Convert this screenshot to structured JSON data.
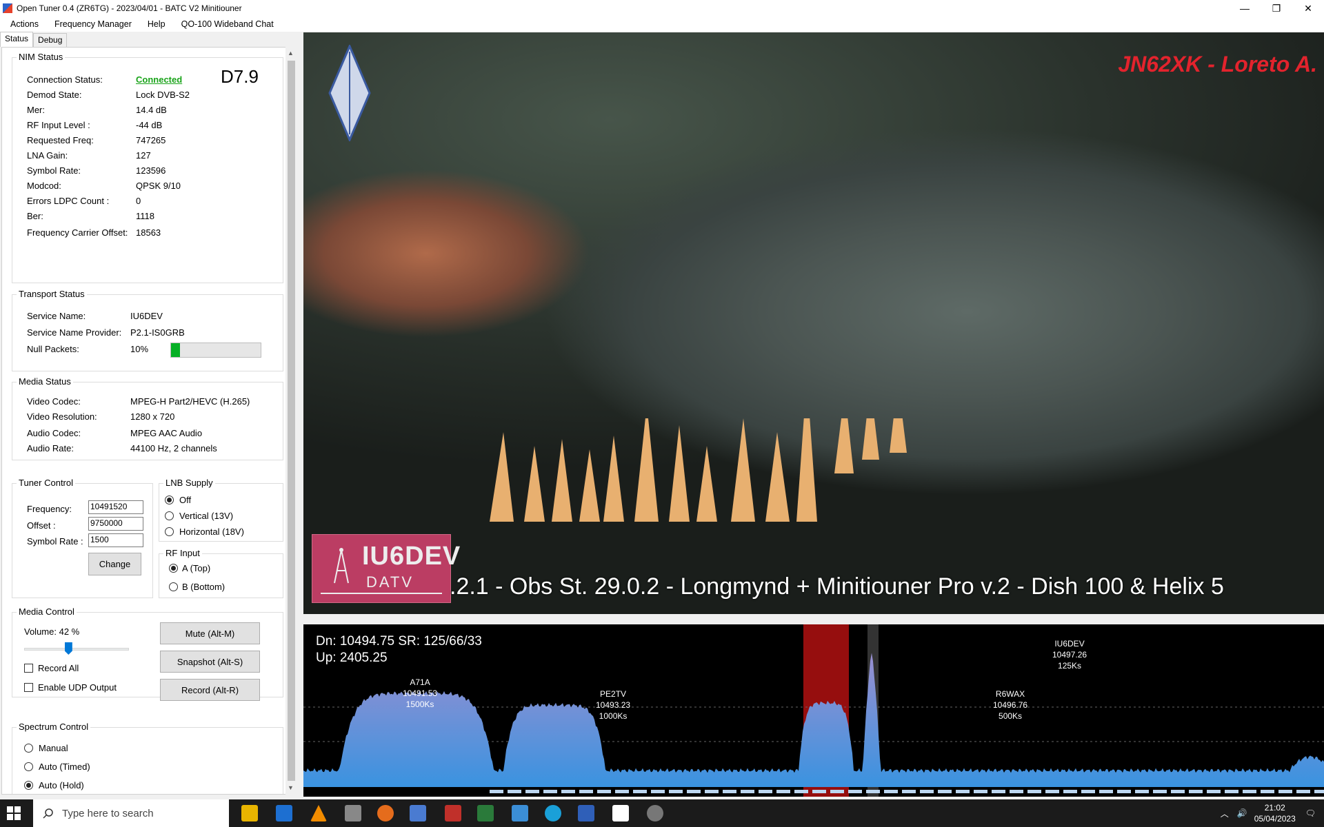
{
  "window": {
    "title": "Open Tuner 0.4 (ZR6TG) - 2023/04/01 - BATC V2 Minitiouner",
    "minimize": "—",
    "restore": "❐",
    "close": "✕"
  },
  "menu": [
    "Actions",
    "Frequency Manager",
    "Help",
    "QO-100 Wideband Chat"
  ],
  "tabs": [
    "Status",
    "Debug"
  ],
  "nim": {
    "title": "NIM Status",
    "badge": "D7.9",
    "rows": [
      {
        "label": "Connection Status:",
        "value": "Connected"
      },
      {
        "label": "Demod State:",
        "value": "Lock DVB-S2"
      },
      {
        "label": "Mer:",
        "value": "14.4 dB"
      },
      {
        "label": "RF Input Level :",
        "value": "-44 dB"
      },
      {
        "label": "Requested Freq:",
        "value": "747265"
      },
      {
        "label": "LNA Gain:",
        "value": "127"
      },
      {
        "label": "Symbol Rate:",
        "value": "123596"
      },
      {
        "label": "Modcod:",
        "value": "QPSK 9/10"
      },
      {
        "label": "Errors LDPC Count :",
        "value": "0"
      },
      {
        "label": "Ber:",
        "value": "1118"
      },
      {
        "label": "Frequency Carrier Offset:",
        "value": "18563"
      }
    ]
  },
  "transport": {
    "title": "Transport Status",
    "service_name_label": "Service Name:",
    "service_name": "IU6DEV",
    "provider_label": "Service Name Provider:",
    "provider": "P2.1-IS0GRB",
    "null_label": "Null Packets:",
    "null_value": "10%",
    "null_fraction": 0.1
  },
  "media": {
    "title": "Media Status",
    "rows": [
      {
        "label": "Video Codec:",
        "value": "MPEG-H Part2/HEVC (H.265)"
      },
      {
        "label": "Video Resolution:",
        "value": "1280 x 720"
      },
      {
        "label": "Audio Codec:",
        "value": "MPEG AAC Audio"
      },
      {
        "label": "Audio Rate:",
        "value": "44100 Hz, 2 channels"
      }
    ]
  },
  "tuner": {
    "title": "Tuner Control",
    "frequency_label": "Frequency:",
    "frequency": "10491520",
    "offset_label": "Offset :",
    "offset": "9750000",
    "symbol_label": "Symbol Rate :",
    "symbol": "1500",
    "change": "Change"
  },
  "lnb": {
    "title": "LNB Supply",
    "options": [
      "Off",
      "Vertical (13V)",
      "Horizontal (18V)"
    ],
    "selected": 0
  },
  "rf": {
    "title": "RF Input",
    "options": [
      "A (Top)",
      "B (Bottom)"
    ],
    "selected": 0
  },
  "media_control": {
    "title": "Media Control",
    "volume_label": "Volume: 42 %",
    "volume_fraction": 0.42,
    "record_all": "Record All",
    "udp": "Enable UDP Output",
    "mute": "Mute (Alt-M)",
    "snapshot": "Snapshot (Alt-S)",
    "record": "Record (Alt-R)"
  },
  "spectrum_control": {
    "title": "Spectrum Control",
    "options": [
      "Manual",
      "Auto (Timed)",
      "Auto (Hold)"
    ],
    "selected": 2
  },
  "video": {
    "callsign_overlay": "JN62XK - Loreto A.",
    "station_logo": "IU6DEV",
    "station_logo_sub": "DATV",
    "crawl": ".2.1 - Obs St. 29.0.2 - Longmynd + Minitiouner Pro v.2 - Dish 100 & Helix 5"
  },
  "spectrum": {
    "dn": "Dn: 10494.75  SR: 125/66/33",
    "up": "Up: 2405.25",
    "signals": [
      {
        "call": "A71A",
        "freq": "10491.53",
        "sr": "1500Ks"
      },
      {
        "call": "PE2TV",
        "freq": "10493.23",
        "sr": "1000Ks"
      },
      {
        "call": "R6WAX",
        "freq": "10496.76",
        "sr": "500Ks"
      },
      {
        "call": "IU6DEV",
        "freq": "10497.26",
        "sr": "125Ks"
      }
    ],
    "colors": {
      "fill_top": "#9a8fd0",
      "fill_bottom": "#3a93e0",
      "highlight": "#b01010"
    }
  },
  "taskbar": {
    "search_placeholder": "Type here to search",
    "time": "21:02",
    "date": "05/04/2023"
  }
}
